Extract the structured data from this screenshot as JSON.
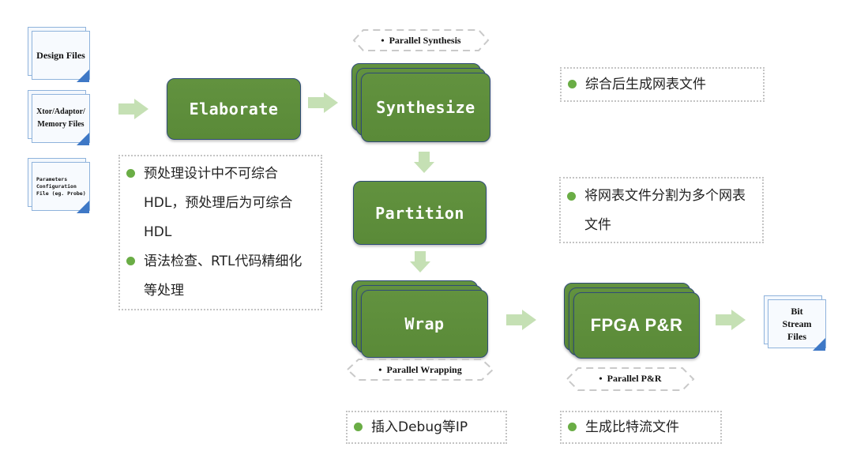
{
  "inputs": [
    {
      "label": "Design Files"
    },
    {
      "label": "Xtor/Adaptor/ Memory Files"
    },
    {
      "label": "Parameters Configuration File (eg. Probe)"
    }
  ],
  "stages": {
    "elaborate": "Elaborate",
    "synthesize": "Synthesize",
    "partition": "Partition",
    "wrap": "Wrap",
    "fpga_pr": "FPGA P&R"
  },
  "tags": {
    "synthesis": "Parallel Synthesis",
    "wrapping": "Parallel Wrapping",
    "pr": "Parallel P&R"
  },
  "output": {
    "label": "Bit Stream Files"
  },
  "notes": {
    "elaborate": [
      "预处理设计中不可综合HDL，预处理后为可综合HDL",
      "语法检查、RTL代码精细化等处理"
    ],
    "synthesize": [
      "综合后生成网表文件"
    ],
    "partition": [
      "将网表文件分割为多个网表文件"
    ],
    "wrap": [
      "插入Debug等IP"
    ],
    "fpga_pr": [
      "生成比特流文件"
    ]
  },
  "colors": {
    "box_fill": "#5e8f3c",
    "box_border": "#2f4b78",
    "arrow": "#c5e0b4",
    "bullet": "#6aad45",
    "doc_border": "#8fb3dc",
    "doc_curl": "#3e78c6"
  }
}
